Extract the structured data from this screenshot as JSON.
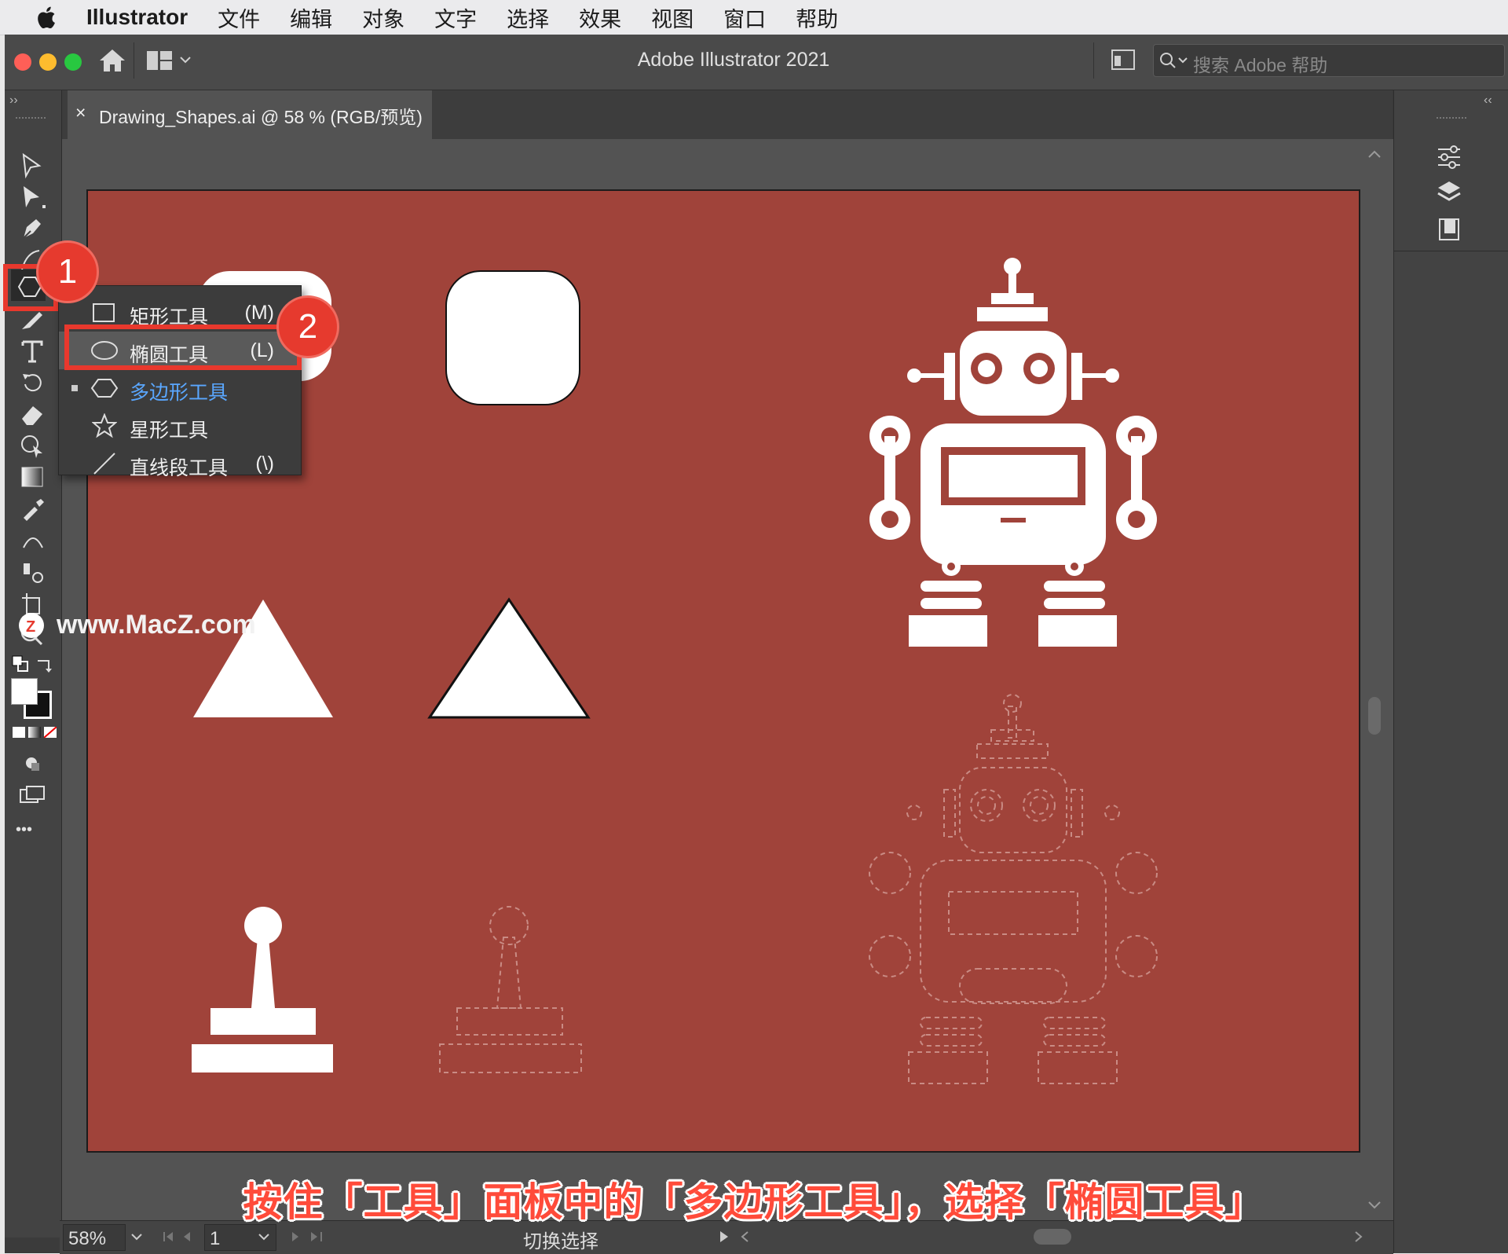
{
  "menubar": {
    "app_name": "Illustrator",
    "items": [
      "文件",
      "编辑",
      "对象",
      "文字",
      "选择",
      "效果",
      "视图",
      "窗口",
      "帮助"
    ]
  },
  "window": {
    "title": "Adobe Illustrator 2021",
    "search_placeholder": "搜索 Adobe 帮助"
  },
  "document_tab": {
    "close": "×",
    "title": "Drawing_Shapes.ai @ 58 % (RGB/预览)"
  },
  "toolbar": {
    "collapse": "››",
    "more": "•••"
  },
  "right_panel": {
    "collapse": "‹‹"
  },
  "flyout": {
    "items": [
      {
        "label": "矩形工具",
        "shortcut": "(M)",
        "icon": "rectangle-icon"
      },
      {
        "label": "椭圆工具",
        "shortcut": "(L)",
        "icon": "ellipse-icon"
      },
      {
        "label": "多边形工具",
        "shortcut": "",
        "icon": "polygon-icon"
      },
      {
        "label": "星形工具",
        "shortcut": "",
        "icon": "star-icon"
      },
      {
        "label": "直线段工具",
        "shortcut": "(\\)",
        "icon": "line-icon"
      }
    ]
  },
  "callouts": {
    "one": "1",
    "two": "2"
  },
  "watermark": "www.MacZ.com",
  "caption": "按住「工具」面板中的「多边形工具」，选择「椭圆工具」",
  "statusbar": {
    "zoom": "58%",
    "artboard": "1",
    "mode": "切换选择"
  },
  "colors": {
    "artboard": "#a0433a",
    "accent_red": "#e8382d",
    "highlight_blue": "#5aa7ff"
  }
}
